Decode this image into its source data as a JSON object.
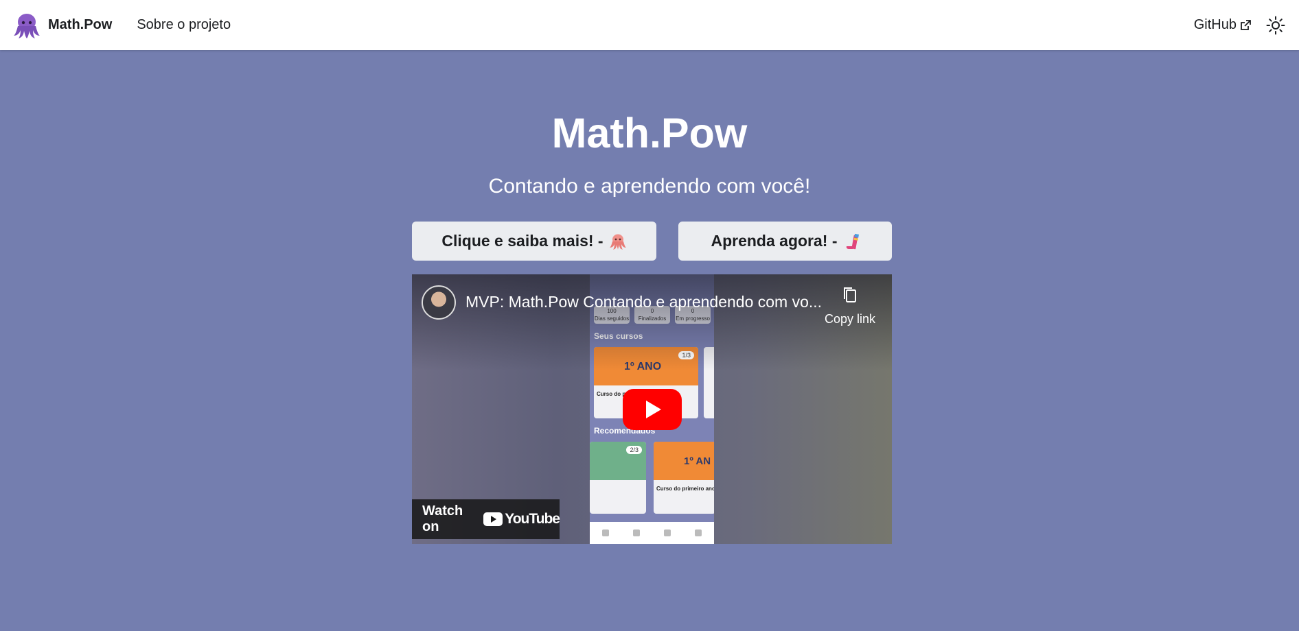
{
  "navbar": {
    "brand": "Math.Pow",
    "about_link": "Sobre o projeto",
    "github_link": "GitHub"
  },
  "hero": {
    "title": "Math.Pow",
    "subtitle": "Contando e aprendendo com você!",
    "btn_more": "Clique e saiba mais! -",
    "btn_learn": "Aprenda agora! -"
  },
  "video": {
    "title": "MVP: Math.Pow Contando e aprendendo com vo...",
    "copy_link": "Copy link",
    "watch_on": "Watch on",
    "youtube": "YouTube",
    "phone": {
      "stats": [
        {
          "value": "100",
          "label": "Dias seguidos"
        },
        {
          "value": "0",
          "label": "Finalizados"
        },
        {
          "value": "0",
          "label": "Em progresso"
        }
      ],
      "section_courses": "Seus cursos",
      "section_recommended": "Recomendados",
      "card_main_tag": "1º ANO",
      "card_main_badge": "1/3",
      "card_main_label": "Curso do p",
      "card_rec1_badge": "2/3",
      "card_rec2_tag": "1º AN",
      "card_rec2_label": "Curso do primeiro ano"
    }
  },
  "colors": {
    "page_bg": "#747eaf",
    "button_bg": "#ebedf0",
    "youtube_red": "#ff0000"
  },
  "icons": [
    "octopus-logo-icon",
    "external-link-icon",
    "sun-icon",
    "octopus-emoji-icon",
    "pencil-emoji-icon",
    "copy-icon",
    "play-icon",
    "youtube-logo-icon"
  ]
}
